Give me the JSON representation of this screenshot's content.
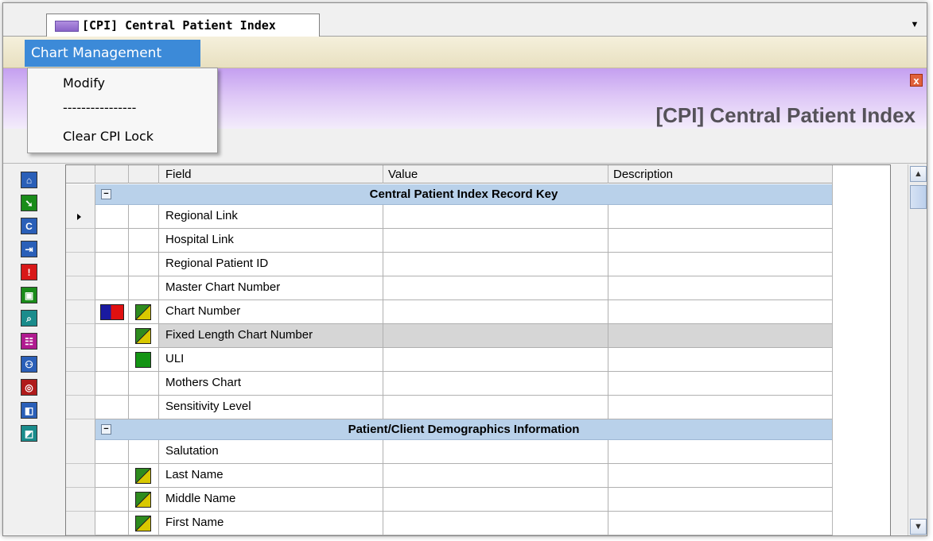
{
  "window": {
    "tab_title": "[CPI] Central Patient Index",
    "banner_title": "[CPI] Central Patient Index",
    "close_glyph": "x"
  },
  "menubar": {
    "chart_management": "Chart Management"
  },
  "dropdown": {
    "items": [
      "Modify",
      "----------------",
      "Clear CPI Lock"
    ]
  },
  "toolbar": {
    "buttons": [
      {
        "icon": "home-icon",
        "glyph": "⌂",
        "color": "#2a5fb8"
      },
      {
        "icon": "arrow-icon",
        "glyph": "➘",
        "color": "#1a8c1a"
      },
      {
        "icon": "c-icon",
        "glyph": "C",
        "color": "#2a5fb8"
      },
      {
        "icon": "login-icon",
        "glyph": "⇥",
        "color": "#2a5fb8"
      },
      {
        "icon": "alert-icon",
        "glyph": "!",
        "color": "#d81818"
      },
      {
        "icon": "clipboard-icon",
        "glyph": "▣",
        "color": "#1a8c1a"
      },
      {
        "icon": "search-icon",
        "glyph": "⌕",
        "color": "#1a8c8c"
      },
      {
        "icon": "people-icon",
        "glyph": "☷",
        "color": "#b01a90"
      },
      {
        "icon": "family-icon",
        "glyph": "⚇",
        "color": "#2a5fb8"
      },
      {
        "icon": "attachment-icon",
        "glyph": "◎",
        "color": "#b01a1a"
      },
      {
        "icon": "chart-icon",
        "glyph": "◧",
        "color": "#2a5fb8"
      },
      {
        "icon": "trend-icon",
        "glyph": "◩",
        "color": "#1a8c8c"
      }
    ]
  },
  "grid": {
    "columns": [
      "Field",
      "Value",
      "Description"
    ],
    "groups": [
      {
        "title": "Central Patient Index Record Key",
        "toggle": "−",
        "rows": [
          {
            "field": "Regional Link",
            "icon1": "",
            "icon2": "",
            "current": true
          },
          {
            "field": "Hospital Link",
            "icon1": "",
            "icon2": ""
          },
          {
            "field": "Regional Patient ID",
            "icon1": "",
            "icon2": ""
          },
          {
            "field": "Master Chart Number",
            "icon1": "",
            "icon2": ""
          },
          {
            "field": "Chart Number",
            "icon1": "flag",
            "icon2": "diag"
          },
          {
            "field": "Fixed Length Chart Number",
            "icon1": "",
            "icon2": "diag",
            "shaded": true
          },
          {
            "field": "ULI",
            "icon1": "",
            "icon2": "green"
          },
          {
            "field": "Mothers Chart",
            "icon1": "",
            "icon2": ""
          },
          {
            "field": "Sensitivity Level",
            "icon1": "",
            "icon2": ""
          }
        ]
      },
      {
        "title": "Patient/Client Demographics Information",
        "toggle": "−",
        "rows": [
          {
            "field": "Salutation",
            "icon1": "",
            "icon2": ""
          },
          {
            "field": "Last Name",
            "icon1": "",
            "icon2": "diag"
          },
          {
            "field": "Middle Name",
            "icon1": "",
            "icon2": "diag"
          },
          {
            "field": "First Name",
            "icon1": "",
            "icon2": "diag"
          }
        ]
      }
    ]
  },
  "scrollbar": {
    "up_glyph": "▲",
    "down_glyph": "▼"
  }
}
